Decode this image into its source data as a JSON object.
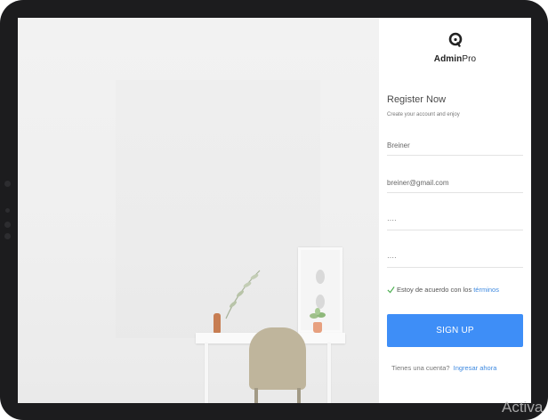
{
  "brand": {
    "name_bold": "Admin",
    "name_light": "Pro"
  },
  "form": {
    "title": "Register Now",
    "subtitle": "Create your account and enjoy",
    "fields": [
      {
        "value": "Breiner",
        "type": "text"
      },
      {
        "value": "breiner@gmail.com",
        "type": "email"
      },
      {
        "value": "····",
        "type": "text"
      },
      {
        "value": "····",
        "type": "text"
      }
    ],
    "terms_text": "Estoy de acuerdo con los",
    "terms_link": "términos",
    "submit_label": "SIGN UP",
    "footer_text": "Tienes una cuenta?",
    "footer_link": "Ingresar ahora"
  },
  "overlay": {
    "watermark": "Activa"
  },
  "colors": {
    "accent": "#3e8ef7",
    "link": "#3f8ae0",
    "check": "#4caf50",
    "frame": "#1c1c1e"
  },
  "icons": [
    "adminpro-logo-icon",
    "check-icon"
  ]
}
